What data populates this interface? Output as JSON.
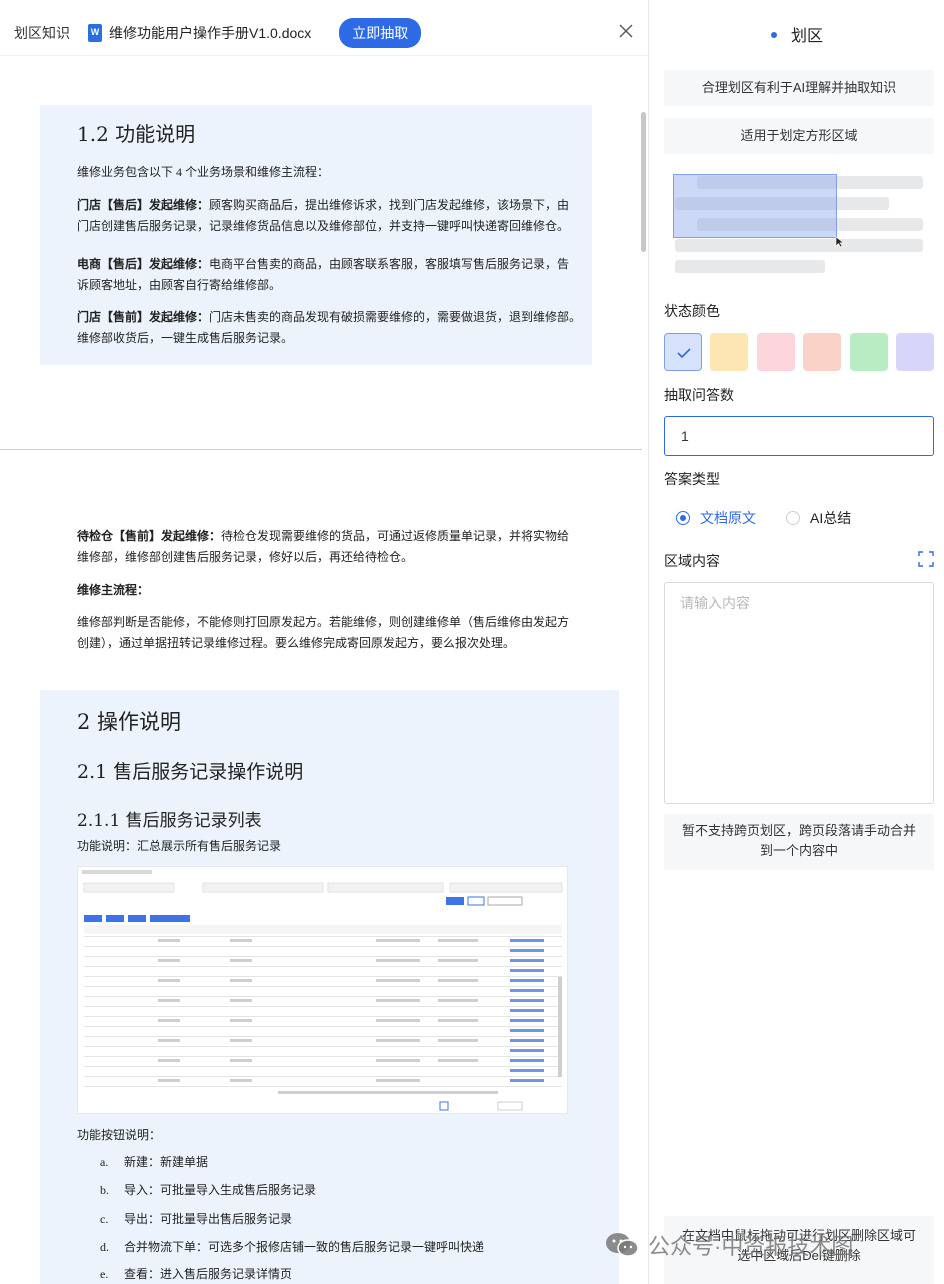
{
  "topbar": {
    "crumb": "划区知识",
    "filename": "维修功能用户操作手册V1.0.docx",
    "extract_label": "立即抽取"
  },
  "doc": {
    "s12_title": "1.2 功能说明",
    "s12_intro": "维修业务包含以下 4 个业务场景和维修主流程：",
    "p1_bold": "门店【售后】发起维修：",
    "p1_line1": "顾客购买商品后，提出维修诉求，找到门店发起维修，该场景下，由",
    "p1_line2": "门店创建售后服务记录，记录维修货品信息以及维修部位，并支持一键呼叫快递寄回维修仓。",
    "p2_bold": "电商【售后】发起维修：",
    "p2_line1": "电商平台售卖的商品，由顾客联系客服，客服填写售后服务记录，告",
    "p2_line2": "诉顾客地址，由顾客自行寄给维修部。",
    "p3_bold": "门店【售前】发起维修：",
    "p3_line1": "门店未售卖的商品发现有破损需要维修的，需要做退货，退到维修部。",
    "p3_line2": "维修部收货后，一键生成售后服务记录。",
    "p4_bold": "待检仓【售前】发起维修：",
    "p4_line1": "待检仓发现需要维修的货品，可通过返修质量单记录，并将实物给",
    "p4_line2": "维修部，维修部创建售后服务记录，修好以后，再还给待检仓。",
    "main_flow_title": "维修主流程：",
    "mf_line1": "维修部判断是否能修，不能修则打回原发起方。若能维修，则创建维修单（售后维修由发起方",
    "mf_line2": "创建），通过单据扭转记录维修过程。要么维修完成寄回原发起方，要么报次处理。",
    "s2_title": "2 操作说明",
    "s21_title": "2.1 售后服务记录操作说明",
    "s211_title": "2.1.1 售后服务记录列表",
    "func_desc": "功能说明：汇总展示所有售后服务记录",
    "buttons_desc": "功能按钮说明：",
    "list": [
      {
        "marker": "a.",
        "text": "新建：新建单据"
      },
      {
        "marker": "b.",
        "text": "导入：可批量导入生成售后服务记录"
      },
      {
        "marker": "c.",
        "text": "导出：可批量导出售后服务记录"
      },
      {
        "marker": "d.",
        "text": "合并物流下单：可选多个报修店铺一致的售后服务记录一键呼叫快递"
      },
      {
        "marker": "e.",
        "text": "查看：进入售后服务记录详情页"
      }
    ]
  },
  "panel": {
    "title": "划区",
    "tip1": "合理划区有利于AI理解并抽取知识",
    "tip2": "适用于划定方形区域",
    "status_color_label": "状态颜色",
    "swatches": [
      "#d6e2fb",
      "#fde6b4",
      "#fbd5d9",
      "#fbd2c8",
      "#b8ecc2",
      "#d7d5fa"
    ],
    "qa_count_label": "抽取问答数",
    "qa_count_value": "1",
    "answer_type_label": "答案类型",
    "answer_options": [
      "文档原文",
      "AI总结"
    ],
    "region_content_label": "区域内容",
    "region_placeholder": "请输入内容",
    "tip3": "暂不支持跨页划区，跨页段落请手动合并到一个内容中",
    "tip4": "在文档中鼠标拖动可进行划区删除区域可选中区域后Del键删除"
  },
  "watermark": {
    "text": "公众号·中资报技术图"
  }
}
